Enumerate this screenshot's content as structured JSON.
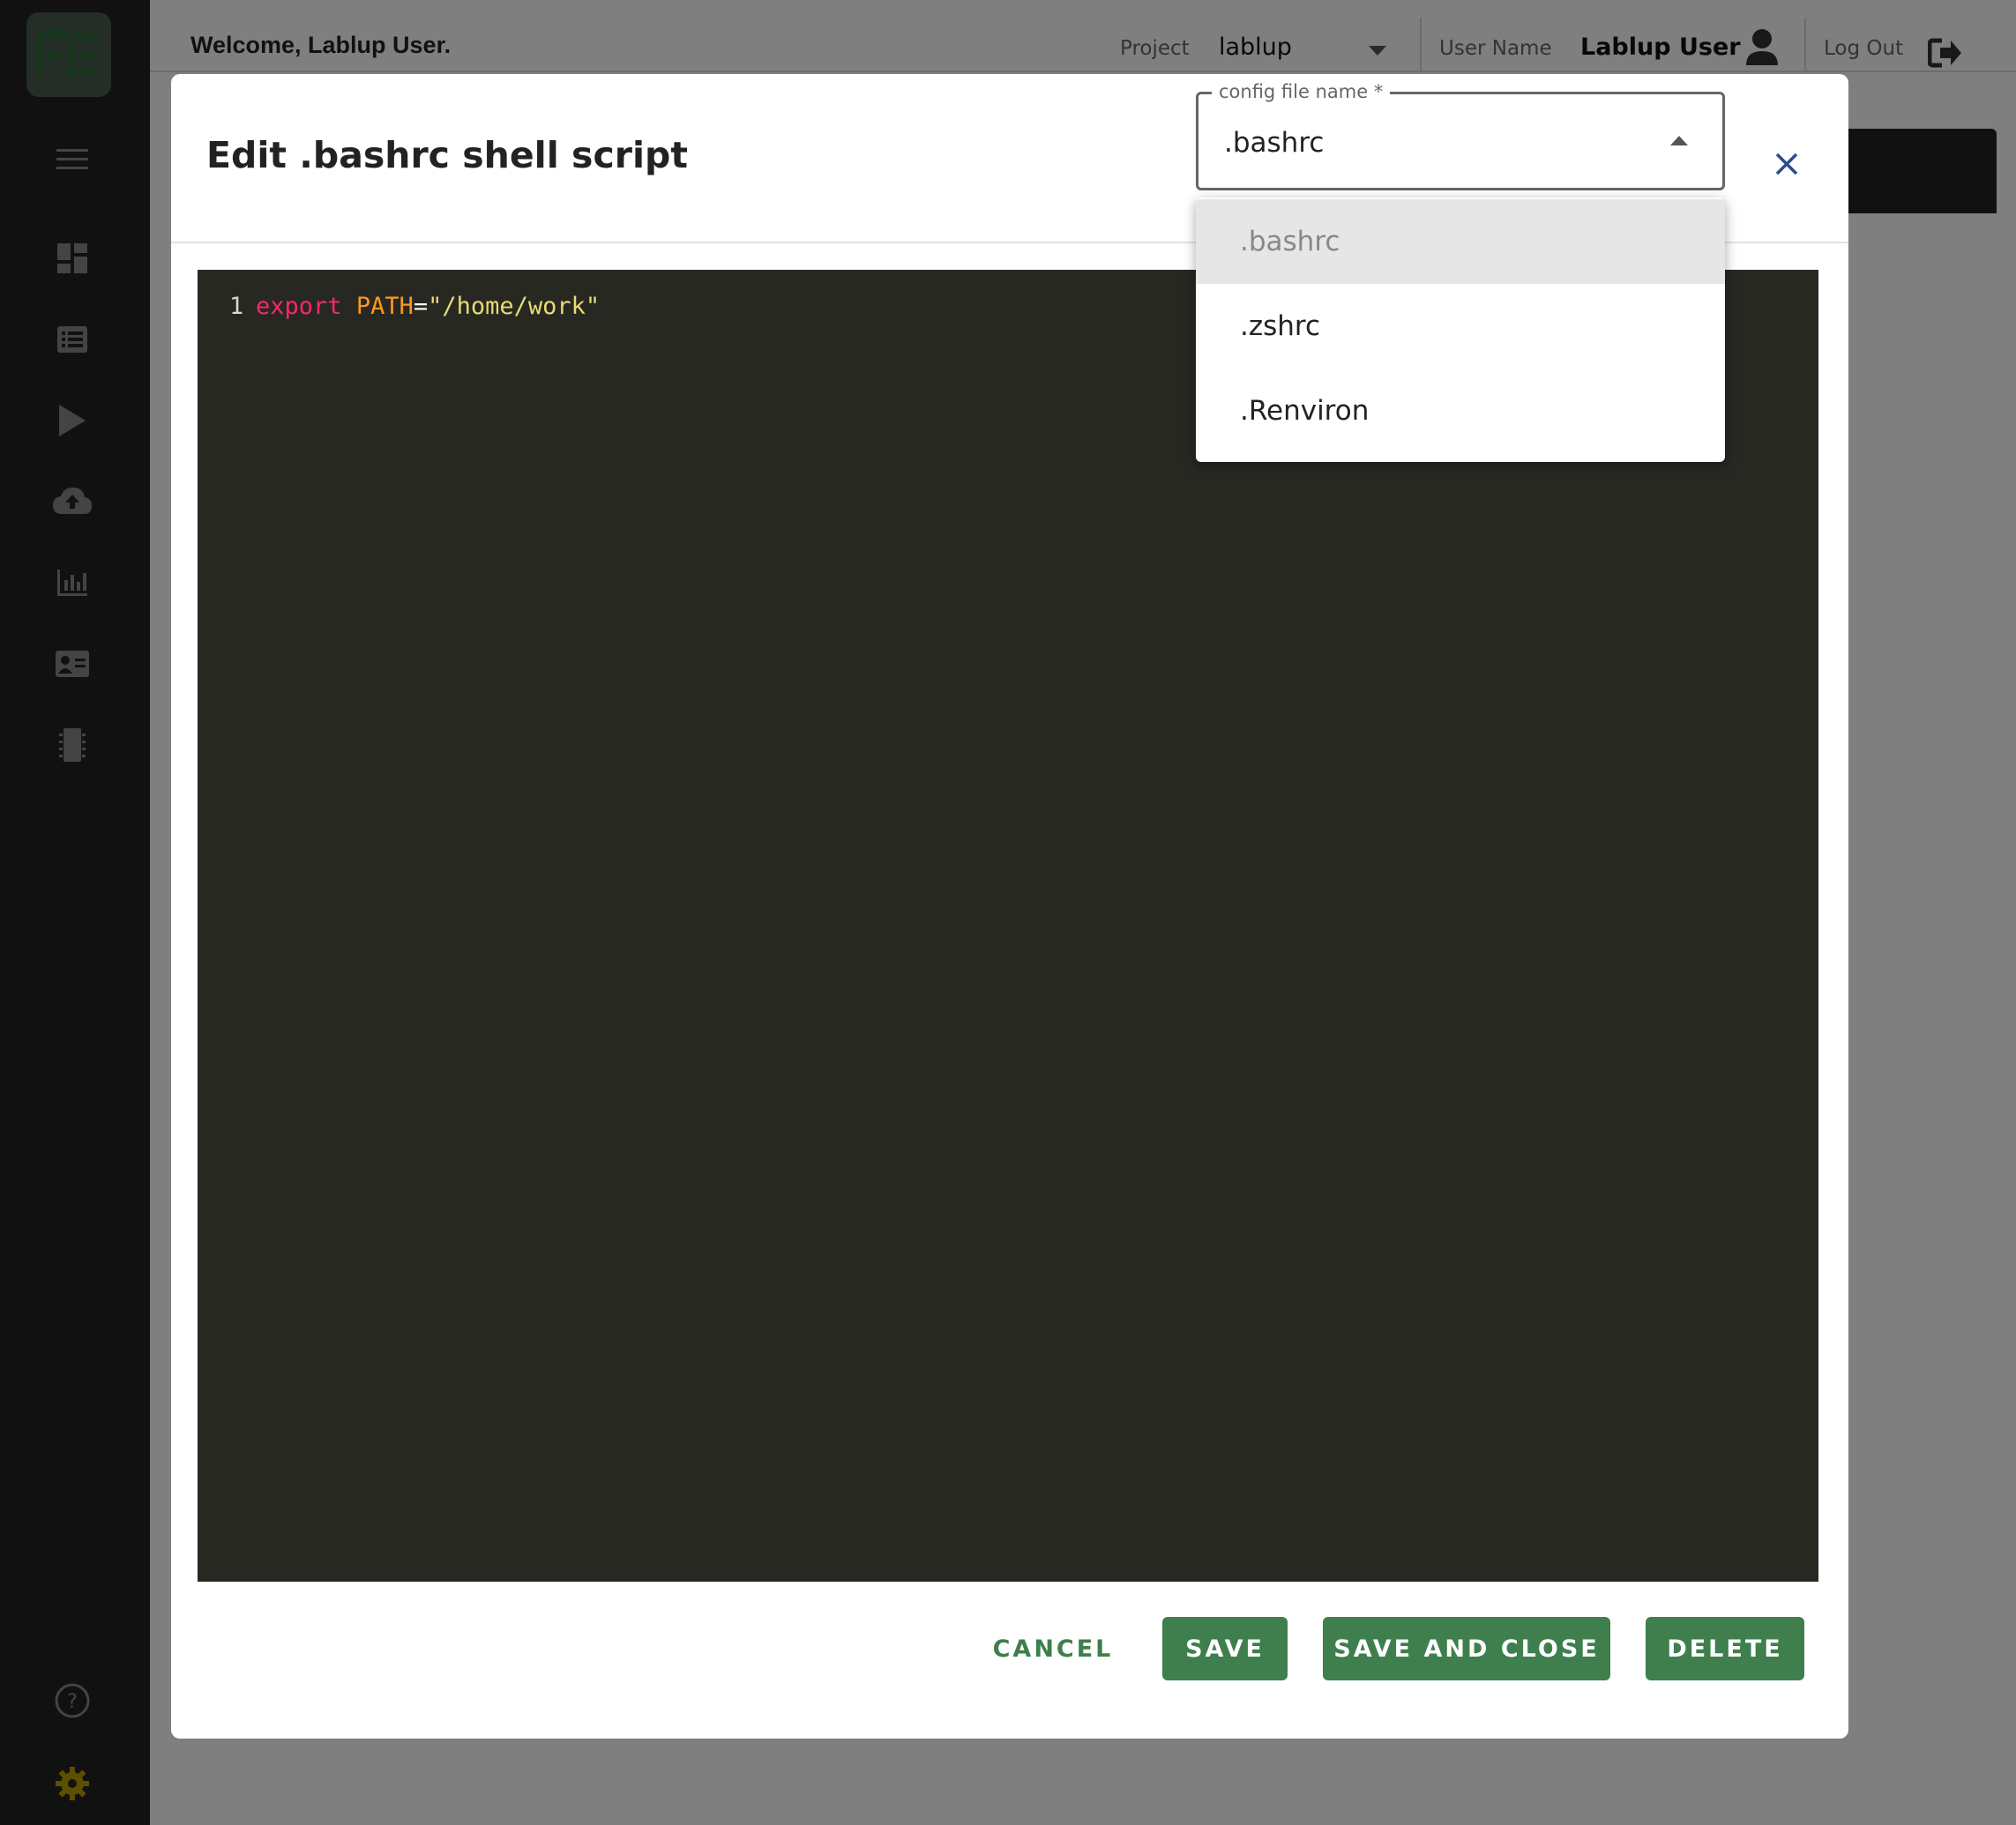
{
  "header": {
    "welcome": "Welcome, Lablup User.",
    "project_label": "Project",
    "project_value": "lablup",
    "username_label": "User Name",
    "username_value": "Lablup User",
    "logout_label": "Log Out"
  },
  "sidebar": {
    "icons": [
      "menu-icon",
      "dashboard-icon",
      "list-icon",
      "play-icon",
      "cloud-upload-icon",
      "bar-chart-icon",
      "id-card-icon",
      "chip-icon",
      "help-icon",
      "settings-icon"
    ]
  },
  "dialog": {
    "title": "Edit .bashrc shell script",
    "select_label": "config file name *",
    "select_value": ".bashrc",
    "options": [
      ".bashrc",
      ".zshrc",
      ".Renviron"
    ],
    "editor": {
      "line_number": "1",
      "code_keyword": "export",
      "code_variable": "PATH",
      "code_operator": "=",
      "code_string": "\"/home/work\""
    },
    "buttons": {
      "cancel": "CANCEL",
      "save": "SAVE",
      "save_and_close": "SAVE AND CLOSE",
      "delete": "DELETE"
    }
  },
  "colors": {
    "accent": "#3e7f4d",
    "sidebar_bg": "#222222",
    "editor_bg": "#272822",
    "settings_icon": "#b8a000"
  }
}
